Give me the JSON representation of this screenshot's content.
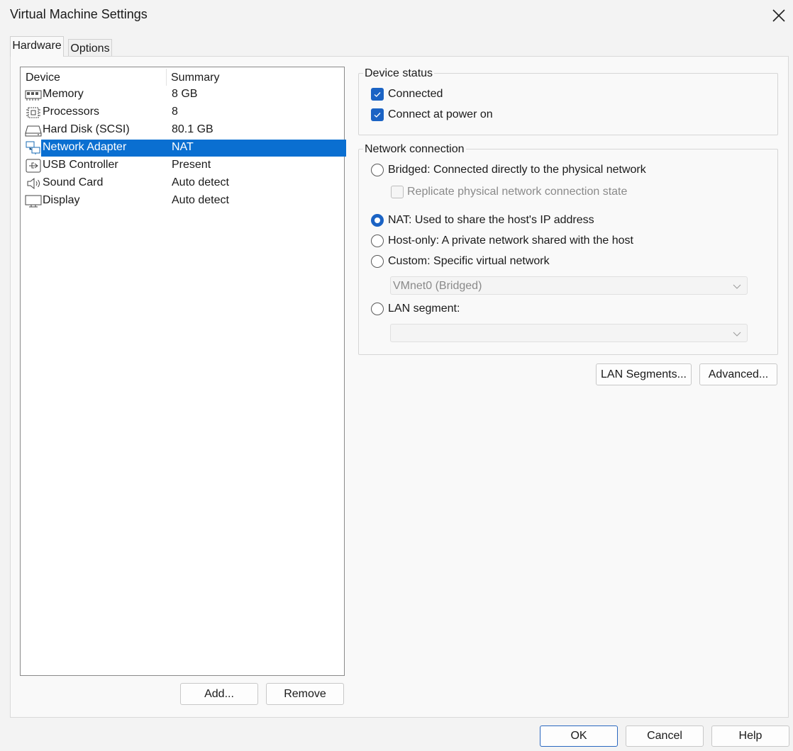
{
  "window": {
    "title": "Virtual Machine Settings",
    "close_icon": "close-icon"
  },
  "tabs": [
    {
      "label": "Hardware",
      "active": true
    },
    {
      "label": "Options",
      "active": false
    }
  ],
  "device_list": {
    "columns": [
      "Device",
      "Summary"
    ],
    "rows": [
      {
        "icon": "memory-icon",
        "device": "Memory",
        "summary": "8 GB",
        "selected": false
      },
      {
        "icon": "processor-icon",
        "device": "Processors",
        "summary": "8",
        "selected": false
      },
      {
        "icon": "hard-disk-icon",
        "device": "Hard Disk (SCSI)",
        "summary": "80.1 GB",
        "selected": false
      },
      {
        "icon": "network-adapter-icon",
        "device": "Network Adapter",
        "summary": "NAT",
        "selected": true
      },
      {
        "icon": "usb-icon",
        "device": "USB Controller",
        "summary": "Present",
        "selected": false
      },
      {
        "icon": "sound-icon",
        "device": "Sound Card",
        "summary": "Auto detect",
        "selected": false
      },
      {
        "icon": "display-icon",
        "device": "Display",
        "summary": "Auto detect",
        "selected": false
      }
    ],
    "add_label": "Add...",
    "remove_label": "Remove"
  },
  "device_status": {
    "label": "Device status",
    "connected": {
      "label": "Connected",
      "checked": true
    },
    "connect_at_power_on": {
      "label": "Connect at power on",
      "checked": true
    }
  },
  "network_connection": {
    "label": "Network connection",
    "bridged": {
      "label": "Bridged: Connected directly to the physical network",
      "selected": false
    },
    "replicate": {
      "label": "Replicate physical network connection state",
      "checked": false
    },
    "nat": {
      "label": "NAT: Used to share the host's IP address",
      "selected": true
    },
    "host_only": {
      "label": "Host-only: A private network shared with the host",
      "selected": false
    },
    "custom": {
      "label": "Custom: Specific virtual network",
      "selected": false
    },
    "custom_select": {
      "value": "VMnet0 (Bridged)"
    },
    "lan_segment": {
      "label": "LAN segment:",
      "selected": false
    },
    "lan_select": {
      "value": ""
    }
  },
  "actions": {
    "lan_segments_label": "LAN Segments...",
    "advanced_label": "Advanced..."
  },
  "footer": {
    "ok_label": "OK",
    "cancel_label": "Cancel",
    "help_label": "Help"
  },
  "colors": {
    "selection": "#0a6fd1",
    "accent": "#1b63c4"
  }
}
